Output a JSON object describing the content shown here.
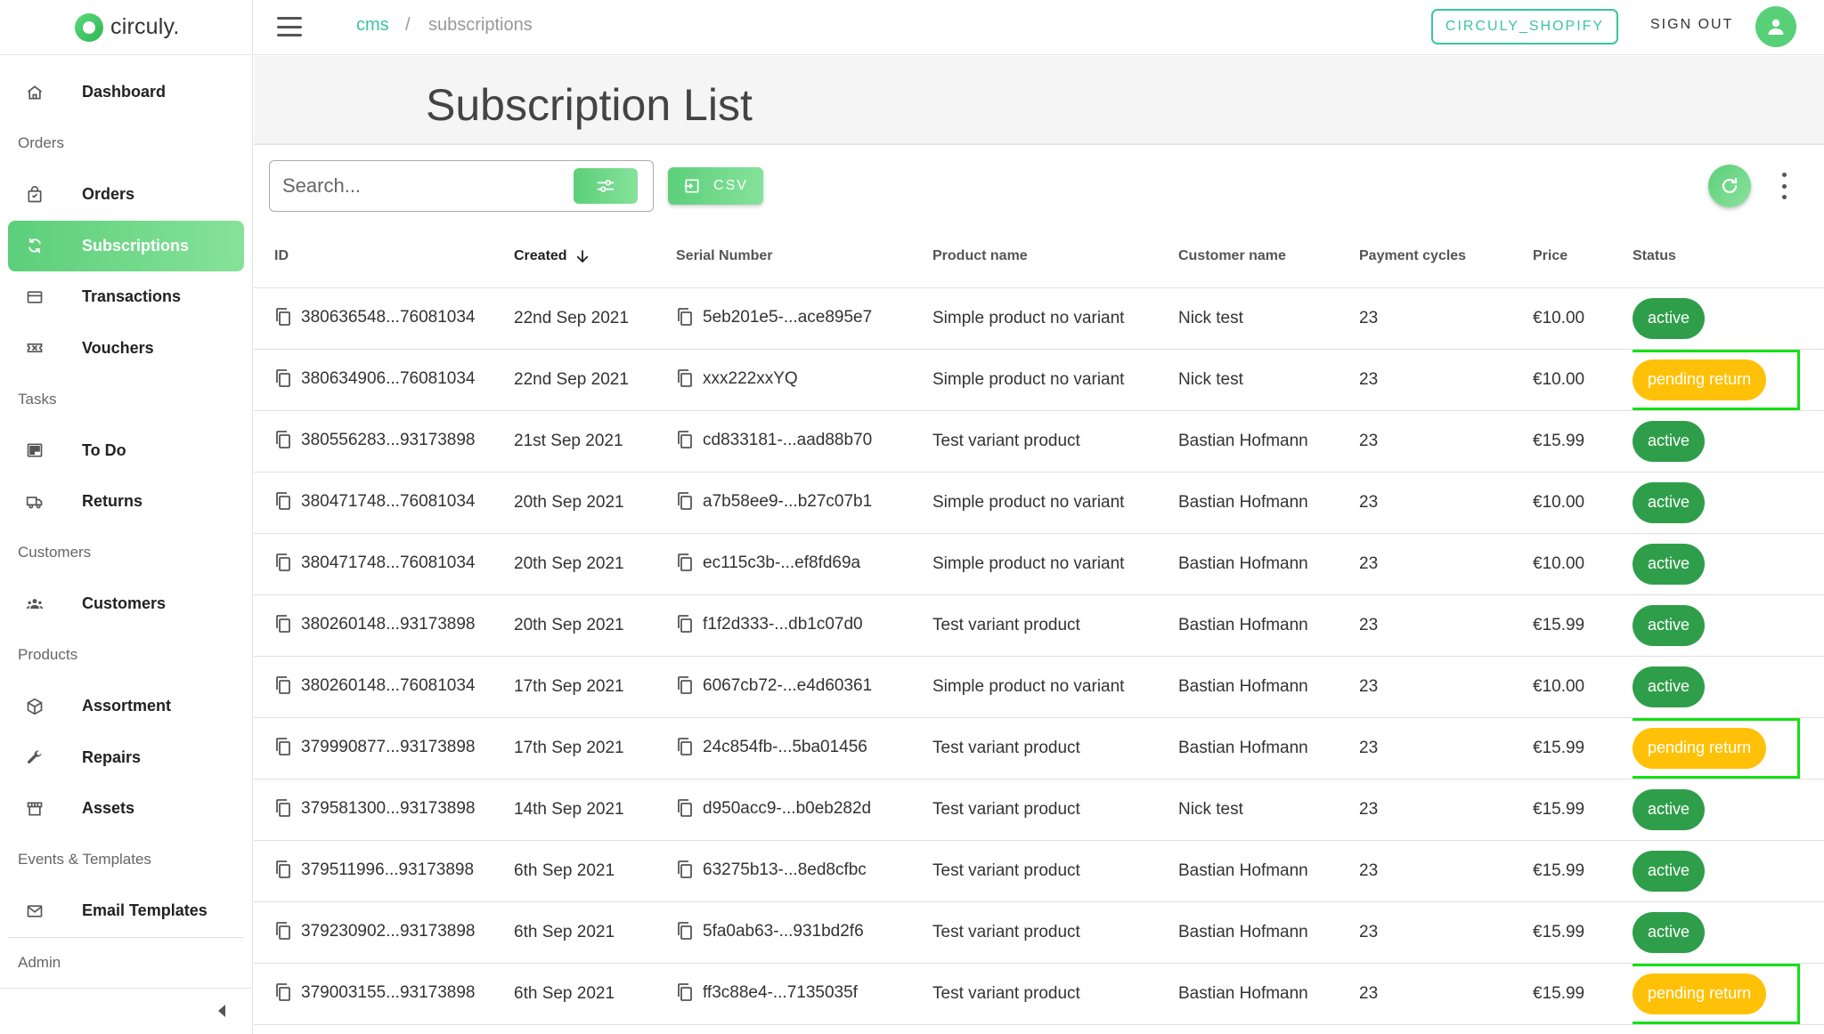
{
  "brand": {
    "name": "circuly."
  },
  "sidebar": {
    "groups": [
      {
        "section": "",
        "items": [
          {
            "label": "Dashboard",
            "icon": "home-icon",
            "active": false
          }
        ]
      },
      {
        "section": "Orders",
        "items": [
          {
            "label": "Orders",
            "icon": "shopping-bag-icon",
            "active": false
          },
          {
            "label": "Subscriptions",
            "icon": "sync-icon",
            "active": true
          },
          {
            "label": "Transactions",
            "icon": "credit-card-icon",
            "active": false
          },
          {
            "label": "Vouchers",
            "icon": "ticket-icon",
            "active": false
          }
        ]
      },
      {
        "section": "Tasks",
        "items": [
          {
            "label": "To Do",
            "icon": "board-icon",
            "active": false
          },
          {
            "label": "Returns",
            "icon": "truck-icon",
            "active": false
          }
        ]
      },
      {
        "section": "Customers",
        "items": [
          {
            "label": "Customers",
            "icon": "people-icon",
            "active": false
          }
        ]
      },
      {
        "section": "Products",
        "items": [
          {
            "label": "Assortment",
            "icon": "cube-icon",
            "active": false
          },
          {
            "label": "Repairs",
            "icon": "wrench-icon",
            "active": false
          },
          {
            "label": "Assets",
            "icon": "store-icon",
            "active": false
          }
        ]
      },
      {
        "section": "Events & Templates",
        "items": [
          {
            "label": "Email Templates",
            "icon": "mail-icon",
            "active": false
          }
        ]
      }
    ],
    "admin_section": "Admin"
  },
  "topbar": {
    "breadcrumb": [
      "cms",
      "/",
      "subscriptions"
    ],
    "shop_button": "CIRCULY_SHOPIFY",
    "signout": "SIGN OUT"
  },
  "page": {
    "title": "Subscription List",
    "search_placeholder": "Search...",
    "csv_label": "CSV"
  },
  "colors": {
    "accent": "#5ccf7a",
    "teal": "#3cc4a0",
    "active_badge": "#2f9e4a",
    "pending_badge": "#ffc107",
    "highlight": "#14e014"
  },
  "table": {
    "columns": [
      "ID",
      "Created",
      "Serial Number",
      "Product name",
      "Customer name",
      "Payment cycles",
      "Price",
      "Status"
    ],
    "rows": [
      {
        "id": "380636548...76081034",
        "created": "22nd Sep 2021",
        "serial": "5eb201e5-...ace895e7",
        "product": "Simple product no variant",
        "customer": "Nick test",
        "cycles": "23",
        "price": "€10.00",
        "status": "active",
        "highlighted": false
      },
      {
        "id": "380634906...76081034",
        "created": "22nd Sep 2021",
        "serial": "xxx222xxYQ",
        "product": "Simple product no variant",
        "customer": "Nick test",
        "cycles": "23",
        "price": "€10.00",
        "status": "pending return",
        "highlighted": true
      },
      {
        "id": "380556283...93173898",
        "created": "21st Sep 2021",
        "serial": "cd833181-...aad88b70",
        "product": "Test variant product",
        "customer": "Bastian Hofmann",
        "cycles": "23",
        "price": "€15.99",
        "status": "active",
        "highlighted": false
      },
      {
        "id": "380471748...76081034",
        "created": "20th Sep 2021",
        "serial": "a7b58ee9-...b27c07b1",
        "product": "Simple product no variant",
        "customer": "Bastian Hofmann",
        "cycles": "23",
        "price": "€10.00",
        "status": "active",
        "highlighted": false
      },
      {
        "id": "380471748...76081034",
        "created": "20th Sep 2021",
        "serial": "ec115c3b-...ef8fd69a",
        "product": "Simple product no variant",
        "customer": "Bastian Hofmann",
        "cycles": "23",
        "price": "€10.00",
        "status": "active",
        "highlighted": false
      },
      {
        "id": "380260148...93173898",
        "created": "20th Sep 2021",
        "serial": "f1f2d333-...db1c07d0",
        "product": "Test variant product",
        "customer": "Bastian Hofmann",
        "cycles": "23",
        "price": "€15.99",
        "status": "active",
        "highlighted": false
      },
      {
        "id": "380260148...76081034",
        "created": "17th Sep 2021",
        "serial": "6067cb72-...e4d60361",
        "product": "Simple product no variant",
        "customer": "Bastian Hofmann",
        "cycles": "23",
        "price": "€10.00",
        "status": "active",
        "highlighted": false
      },
      {
        "id": "379990877...93173898",
        "created": "17th Sep 2021",
        "serial": "24c854fb-...5ba01456",
        "product": "Test variant product",
        "customer": "Bastian Hofmann",
        "cycles": "23",
        "price": "€15.99",
        "status": "pending return",
        "highlighted": true
      },
      {
        "id": "379581300...93173898",
        "created": "14th Sep 2021",
        "serial": "d950acc9-...b0eb282d",
        "product": "Test variant product",
        "customer": "Nick test",
        "cycles": "23",
        "price": "€15.99",
        "status": "active",
        "highlighted": false
      },
      {
        "id": "379511996...93173898",
        "created": "6th Sep 2021",
        "serial": "63275b13-...8ed8cfbc",
        "product": "Test variant product",
        "customer": "Bastian Hofmann",
        "cycles": "23",
        "price": "€15.99",
        "status": "active",
        "highlighted": false
      },
      {
        "id": "379230902...93173898",
        "created": "6th Sep 2021",
        "serial": "5fa0ab63-...931bd2f6",
        "product": "Test variant product",
        "customer": "Bastian Hofmann",
        "cycles": "23",
        "price": "€15.99",
        "status": "active",
        "highlighted": false
      },
      {
        "id": "379003155...93173898",
        "created": "6th Sep 2021",
        "serial": "ff3c88e4-...7135035f",
        "product": "Test variant product",
        "customer": "Bastian Hofmann",
        "cycles": "23",
        "price": "€15.99",
        "status": "pending return",
        "highlighted": true
      }
    ]
  }
}
